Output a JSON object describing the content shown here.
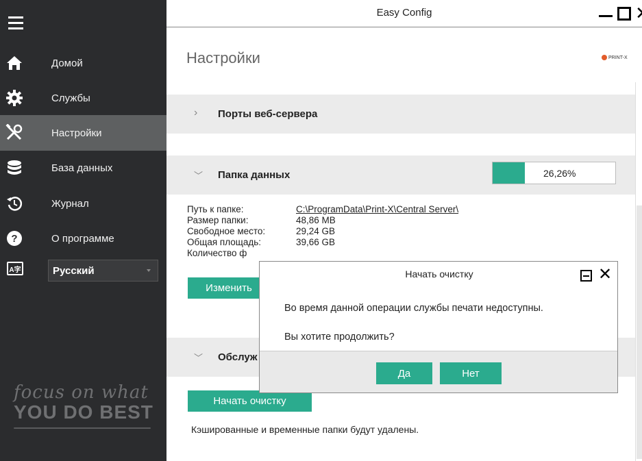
{
  "window": {
    "title": "Easy Config"
  },
  "sidebar": {
    "items": [
      {
        "label": "Домой",
        "icon": "home-icon"
      },
      {
        "label": "Службы",
        "icon": "gear-icon"
      },
      {
        "label": "Настройки",
        "icon": "tools-icon",
        "active": true
      },
      {
        "label": "База данных",
        "icon": "database-icon"
      },
      {
        "label": "Журнал",
        "icon": "history-icon"
      },
      {
        "label": "О программе",
        "icon": "help-icon"
      }
    ],
    "language": {
      "icon_text": "A字",
      "selected": "Русский"
    },
    "tagline": {
      "line1": "focus on what",
      "line2": "YOU DO BEST"
    }
  },
  "main": {
    "title": "Настройки",
    "logo_text": "PRINT-X",
    "sections": {
      "web_ports": {
        "label": "Порты веб-сервера"
      },
      "data_folder": {
        "label": "Папка данных",
        "usage_percent_label": "26,26%",
        "usage_fraction": 0.2626,
        "rows": [
          {
            "key": "Путь к папке:",
            "value": "C:\\ProgramData\\Print-X\\Central Server\\"
          },
          {
            "key": "Размер папки:",
            "value": "48,86 MB"
          },
          {
            "key": "Свободное место:",
            "value": "29,24 GB"
          },
          {
            "key": "Общая площадь:",
            "value": "39,66 GB"
          },
          {
            "key": "Количество ф",
            "value": ""
          }
        ],
        "change_button": "Изменить"
      },
      "maintenance": {
        "label": "Обслуж",
        "cleanup_button": "Начать очистку",
        "note": "Кэшированные и временные папки будут удалены."
      }
    }
  },
  "dialog": {
    "title": "Начать очистку",
    "message": "Во время данной операции службы печати недоступны.",
    "question": "Вы хотите продолжить?",
    "yes": "Да",
    "no": "Нет"
  },
  "colors": {
    "accent": "#2bab8e",
    "sidebar": "#2b2c2e",
    "sidebar_active": "#5e6061"
  }
}
